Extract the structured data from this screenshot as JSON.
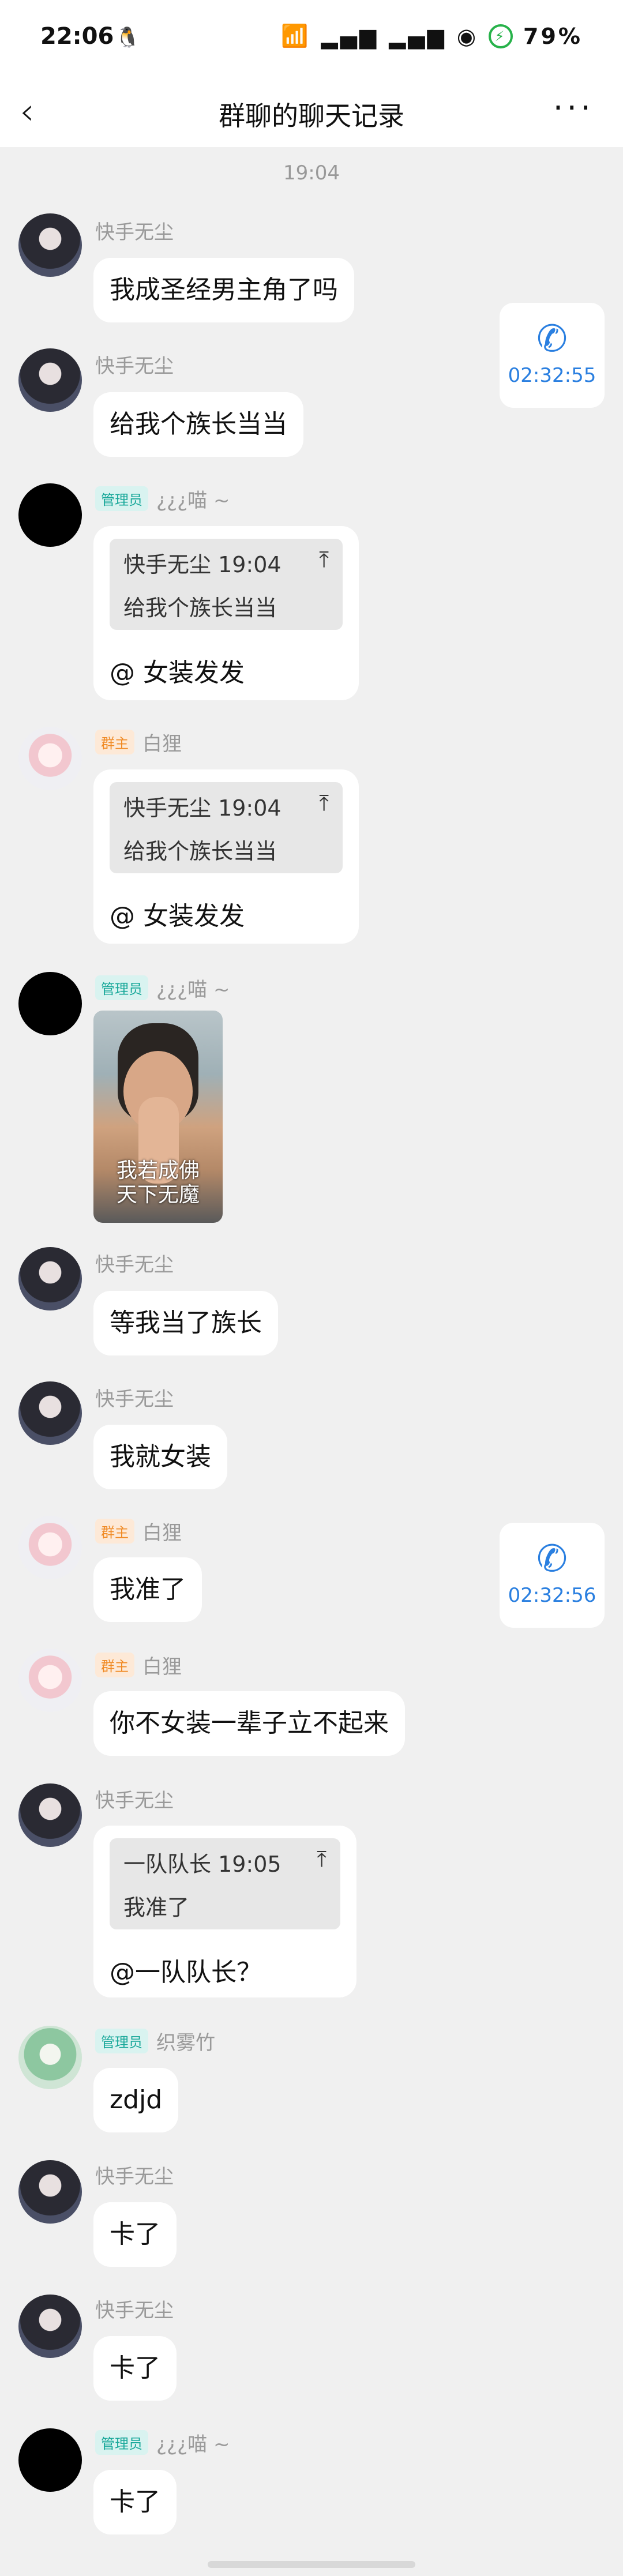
{
  "status_bar": {
    "time": "22:06",
    "battery": "79%",
    "signal_icons": "wifi-icon 5G-signal-icon 5G-signal-icon hotspot-icon"
  },
  "header": {
    "title": "群聊的聊天记录",
    "back": "‹",
    "more": "···"
  },
  "timestamp": "19:04",
  "badges": {
    "admin": "管理员",
    "owner": "群主"
  },
  "call_cards": [
    {
      "duration": "02:32:55"
    },
    {
      "duration": "02:32:56"
    }
  ],
  "messages": [
    {
      "sender": "快手无尘",
      "text": "我成圣经男主角了吗"
    },
    {
      "sender": "快手无尘",
      "text": "给我个族长当当"
    },
    {
      "sender": "¿¿¿喵 ~",
      "quote_head": "快手无尘 19:04",
      "quote_body": "给我个族长当当",
      "text": "@    女装发发"
    },
    {
      "sender": "白狸",
      "quote_head": "快手无尘 19:04",
      "quote_body": "给我个族长当当",
      "text": "@    女装发发"
    },
    {
      "sender": "¿¿¿喵 ~",
      "image_caption_1": "我若成佛",
      "image_caption_2": "天下无魔"
    },
    {
      "sender": "快手无尘",
      "text": "等我当了族长"
    },
    {
      "sender": "快手无尘",
      "text": "我就女装"
    },
    {
      "sender": "白狸",
      "text": "我准了"
    },
    {
      "sender": "白狸",
      "text": "你不女装一辈子立不起来"
    },
    {
      "sender": "快手无尘",
      "quote_head": "一队队长 19:05",
      "quote_body": "我准了",
      "text": "@一队队长？"
    },
    {
      "sender": "织雾竹",
      "text": "zdjd"
    },
    {
      "sender": "快手无尘",
      "text": "卡了"
    },
    {
      "sender": "快手无尘",
      "text": "卡了"
    },
    {
      "sender": "¿¿¿喵 ~",
      "text": "卡了"
    }
  ]
}
